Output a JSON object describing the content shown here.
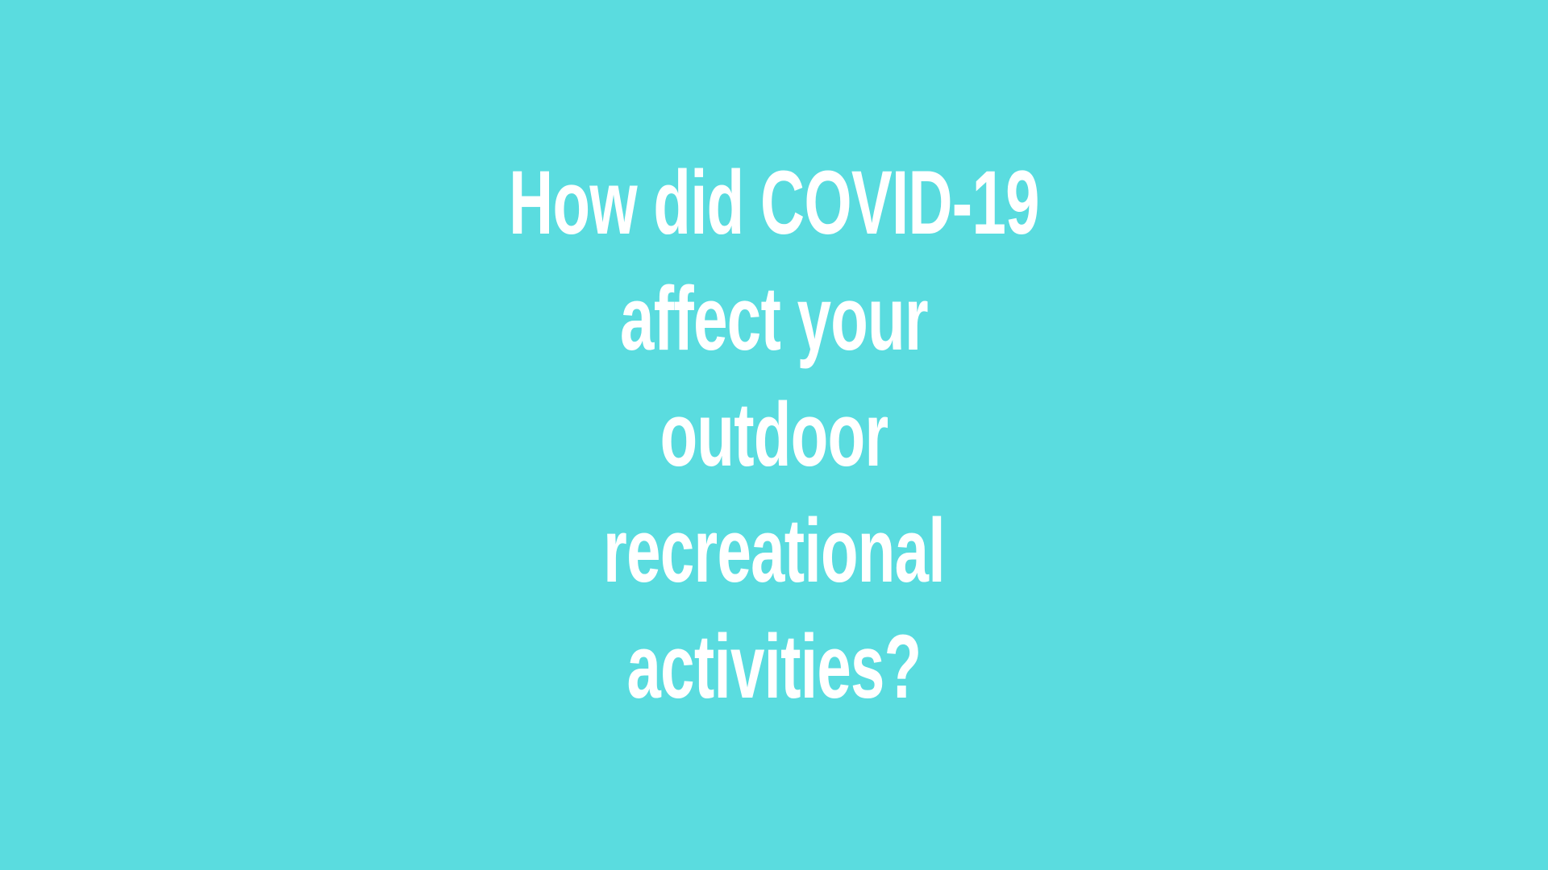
{
  "background_color": "#5ADCDF",
  "text_color": "#FFFFFF",
  "headline": {
    "lines": [
      "How did COVID-19",
      "affect your",
      "outdoor",
      "recreational",
      "activities?"
    ]
  }
}
